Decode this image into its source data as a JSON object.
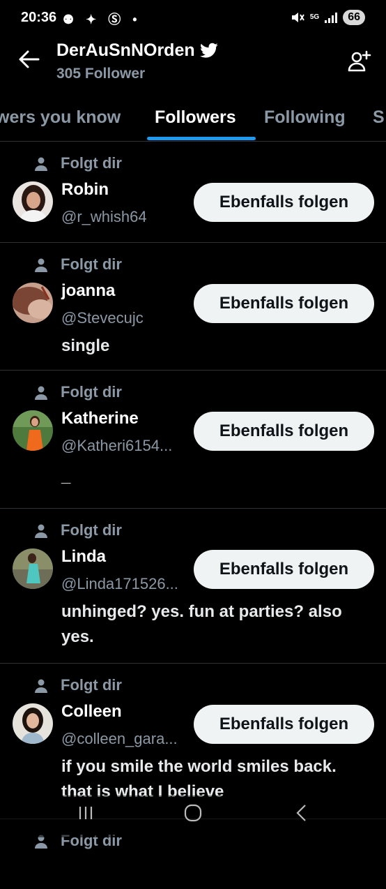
{
  "status_bar": {
    "time": "20:36",
    "left_icons": "⚉ ✦ Ⓢ •",
    "network": "5G",
    "battery": "66"
  },
  "header": {
    "title": "DerAuSnNOrden",
    "subtitle": "305 Follower"
  },
  "tabs": [
    {
      "label": "wers you know"
    },
    {
      "label": "Followers"
    },
    {
      "label": "Following"
    },
    {
      "label": "S"
    }
  ],
  "follow_label": "Ebenfalls folgen",
  "followers": [
    {
      "follows_you": "Folgt dir",
      "name": "Robin",
      "handle": "@r_whish64",
      "bio": ""
    },
    {
      "follows_you": "Folgt dir",
      "name": "joanna",
      "handle": "@Stevecujc",
      "bio": "single"
    },
    {
      "follows_you": "Folgt dir",
      "name": "Katherine",
      "handle": "@Katheri6154...",
      "bio": "_"
    },
    {
      "follows_you": "Folgt dir",
      "name": "Linda",
      "handle": "@Linda171526...",
      "bio": "unhinged? yes. fun at parties? also yes."
    },
    {
      "follows_you": "Folgt dir",
      "name": "Colleen",
      "handle": "@colleen_gara...",
      "bio": "if you smile the world smiles back. that is what I believe"
    },
    {
      "follows_you": "Folgt dir"
    }
  ],
  "colors": {
    "accent": "#1d9bf0",
    "background": "#000000",
    "secondary_text": "#8b98a5",
    "button_bg": "#eff3f4"
  }
}
